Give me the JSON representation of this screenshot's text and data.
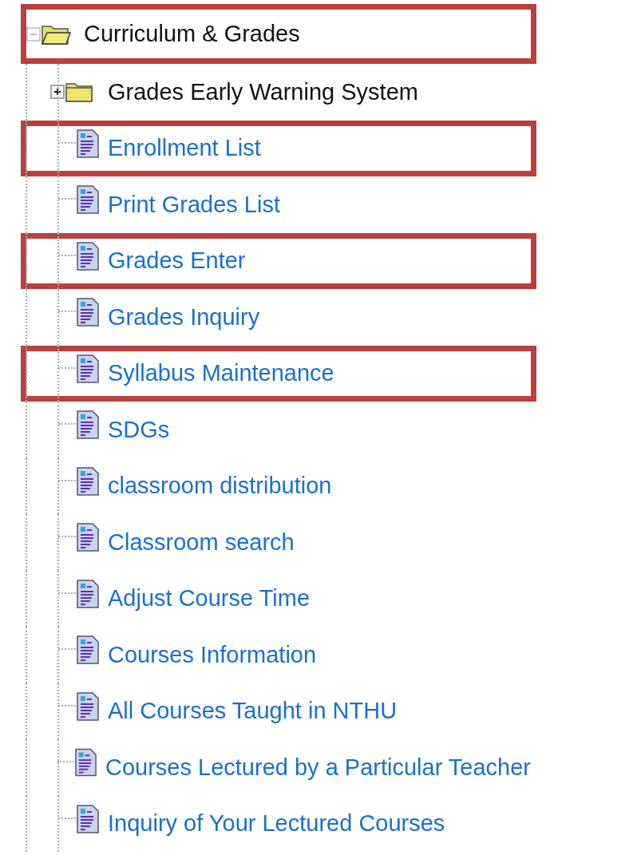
{
  "tree": {
    "label": "Curriculum & Grades",
    "expanded": true,
    "highlighted": true,
    "children": [
      {
        "kind": "folder",
        "label": "Grades Early Warning System",
        "expanded": false,
        "highlighted": false
      },
      {
        "kind": "page",
        "label": "Enrollment List",
        "highlighted": true
      },
      {
        "kind": "page",
        "label": "Print Grades List",
        "highlighted": false
      },
      {
        "kind": "page",
        "label": "Grades Enter",
        "highlighted": true
      },
      {
        "kind": "page",
        "label": "Grades Inquiry",
        "highlighted": false
      },
      {
        "kind": "page",
        "label": "Syllabus Maintenance",
        "highlighted": true
      },
      {
        "kind": "page",
        "label": "SDGs",
        "highlighted": false
      },
      {
        "kind": "page",
        "label": "classroom distribution",
        "highlighted": false
      },
      {
        "kind": "page",
        "label": "Classroom search",
        "highlighted": false
      },
      {
        "kind": "page",
        "label": "Adjust Course Time",
        "highlighted": false
      },
      {
        "kind": "page",
        "label": "Courses Information",
        "highlighted": false
      },
      {
        "kind": "page",
        "label": "All Courses Taught in NTHU",
        "highlighted": false
      },
      {
        "kind": "page",
        "label": "Courses Lectured by a Particular Teacher",
        "highlighted": false
      },
      {
        "kind": "page",
        "label": "Inquiry of Your Lectured Courses",
        "highlighted": false
      }
    ]
  }
}
